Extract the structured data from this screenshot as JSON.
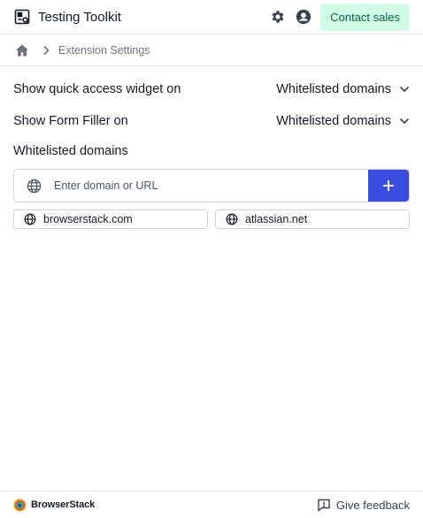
{
  "header": {
    "title": "Testing Toolkit",
    "contact_label": "Contact sales",
    "icons": {
      "logo": "toolkit-logo-icon",
      "settings": "gear-icon",
      "account": "user-circle-icon"
    }
  },
  "breadcrumb": {
    "home_icon": "home-icon",
    "separator_icon": "chevron-right-icon",
    "current": "Extension Settings"
  },
  "settings": {
    "quick_access": {
      "label": "Show quick access widget on",
      "value": "Whitelisted domains"
    },
    "form_filler": {
      "label": "Show Form Filler on",
      "value": "Whitelisted domains"
    }
  },
  "whitelist": {
    "title": "Whitelisted domains",
    "input": {
      "placeholder": "Enter domain or URL",
      "value": ""
    },
    "add_icon": "plus-icon",
    "domains": [
      {
        "label": "browserstack.com",
        "icon": "globe-icon"
      },
      {
        "label": "atlassian.net",
        "icon": "globe-icon"
      }
    ]
  },
  "footer": {
    "brand": "BrowserStack",
    "feedback_label": "Give feedback",
    "feedback_icon": "message-alert-icon"
  },
  "colors": {
    "accent": "#3b4de0",
    "contact_bg": "#d1fae5",
    "contact_text": "#065f46",
    "border": "#e5e7eb"
  }
}
